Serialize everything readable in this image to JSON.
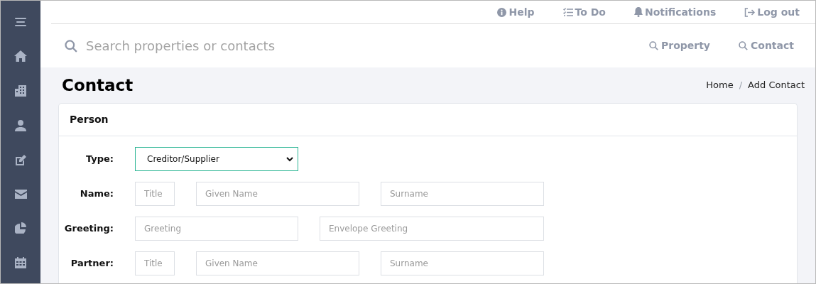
{
  "top_links": [
    {
      "kind": "info",
      "label": "Help"
    },
    {
      "kind": "checklist",
      "label": "To Do"
    },
    {
      "kind": "bell",
      "label": "Notifications"
    },
    {
      "kind": "logout",
      "label": "Log out"
    }
  ],
  "search": {
    "placeholder": "Search properties or contacts",
    "scopes": [
      "Property",
      "Contact"
    ]
  },
  "page_title": "Contact",
  "breadcrumb": [
    {
      "label": "Home"
    },
    {
      "label": "Add Contact"
    }
  ],
  "breadcrumb_separator": "/",
  "card": {
    "title": "Person",
    "rows": [
      {
        "label": "Type:",
        "fields": [
          {
            "kind": "select",
            "value": "Creditor/Supplier"
          }
        ]
      },
      {
        "label": "Name:",
        "fields": [
          {
            "kind": "short",
            "placeholder": "Title"
          },
          {
            "kind": "medium",
            "placeholder": "Given Name"
          },
          {
            "kind": "medium",
            "placeholder": "Surname"
          }
        ]
      },
      {
        "label": "Greeting:",
        "fields": [
          {
            "kind": "medium",
            "placeholder": "Greeting"
          },
          {
            "kind": "long",
            "placeholder": "Envelope Greeting"
          }
        ]
      },
      {
        "label": "Partner:",
        "fields": [
          {
            "kind": "short",
            "placeholder": "Title"
          },
          {
            "kind": "medium",
            "placeholder": "Given Name"
          },
          {
            "kind": "medium",
            "placeholder": "Surname"
          }
        ]
      }
    ]
  }
}
